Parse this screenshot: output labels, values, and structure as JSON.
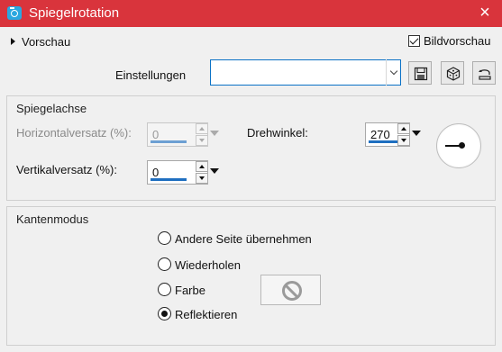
{
  "window": {
    "title": "Spiegelrotation",
    "title_bar_color": "#d9343c",
    "close_icon": "×"
  },
  "preview": {
    "label": "Vorschau",
    "expand_icon": "triangle-right-icon",
    "bildvorschau_label": "Bildvorschau",
    "bildvorschau_checked": true
  },
  "settings": {
    "label": "Einstellungen",
    "value": "",
    "buttons": [
      "save-preset-icon",
      "random-icon",
      "reset-icon"
    ]
  },
  "spiegelachse": {
    "title": "Spiegelachse",
    "horizontal": {
      "label": "Horizontalversatz (%):",
      "value": "0",
      "enabled": false
    },
    "vertical": {
      "label": "Vertikalversatz (%):",
      "value": "0",
      "enabled": true
    },
    "rotation": {
      "label": "Drehwinkel:",
      "value": "270"
    }
  },
  "kantenmodus": {
    "title": "Kantenmodus",
    "options": [
      {
        "label": "Andere Seite übernehmen",
        "selected": false
      },
      {
        "label": "Wiederholen",
        "selected": false
      },
      {
        "label": "Farbe",
        "selected": false
      },
      {
        "label": "Reflektieren",
        "selected": true
      }
    ],
    "color_swatch_icon": "no-color-icon"
  }
}
